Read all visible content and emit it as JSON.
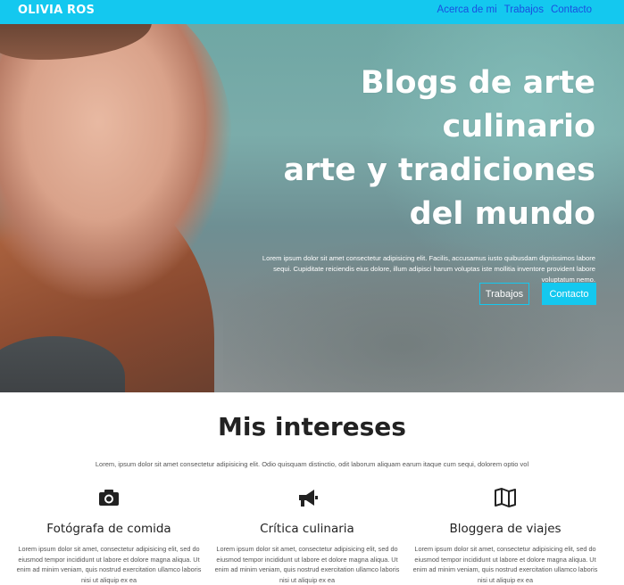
{
  "brand": "OLIVIA ROS",
  "nav": [
    {
      "label": "Acerca de mi"
    },
    {
      "label": "Trabajos"
    },
    {
      "label": "Contacto"
    }
  ],
  "hero": {
    "title_lines": [
      "Blogs de arte",
      "culinario",
      "arte y tradiciones",
      "del mundo"
    ],
    "text": "Lorem ipsum dolor sit amet consectetur adipisicing elit. Facilis, accusamus iusto quibusdam dignissimos labore sequi. Cupiditate reiciendis eius dolore, illum adipisci harum voluptas iste mollitia inventore provident labore voluptatum nemo.",
    "btn_works": "Trabajos",
    "btn_contact": "Contacto"
  },
  "interests": {
    "title": "Mis intereses",
    "subtitle": "Lorem, ipsum dolor sit amet consectetur adipisicing elit. Odio quisquam distinctio, odit laborum aliquam earum itaque cum sequi, dolorem optio vol",
    "cards": [
      {
        "icon": "camera-icon",
        "title": "Fotógrafa de comida",
        "text": "Lorem ipsum dolor sit amet, consectetur adipisicing elit, sed do eiusmod tempor incididunt ut labore et dolore magna aliqua. Ut enim ad minim veniam, quis nostrud exercitation ullamco laboris nisi ut aliquip ex ea"
      },
      {
        "icon": "megaphone-icon",
        "title": "Crítica culinaria",
        "text": "Lorem ipsum dolor sit amet, consectetur adipisicing elit, sed do eiusmod tempor incididunt ut labore et dolore magna aliqua. Ut enim ad minim veniam, quis nostrud exercitation ullamco laboris nisi ut aliquip ex ea"
      },
      {
        "icon": "map-icon",
        "title": "Bloggera de viajes",
        "text": "Lorem ipsum dolor sit amet, consectetur adipisicing elit, sed do eiusmod tempor incididunt ut labore et dolore magna aliqua. Ut enim ad minim veniam, quis nostrud exercitation ullamco laboris nisi ut aliquip ex ea"
      }
    ]
  },
  "colors": {
    "accent": "#14c8ef",
    "nav_link": "#1a4fe0",
    "heading": "#222222"
  }
}
